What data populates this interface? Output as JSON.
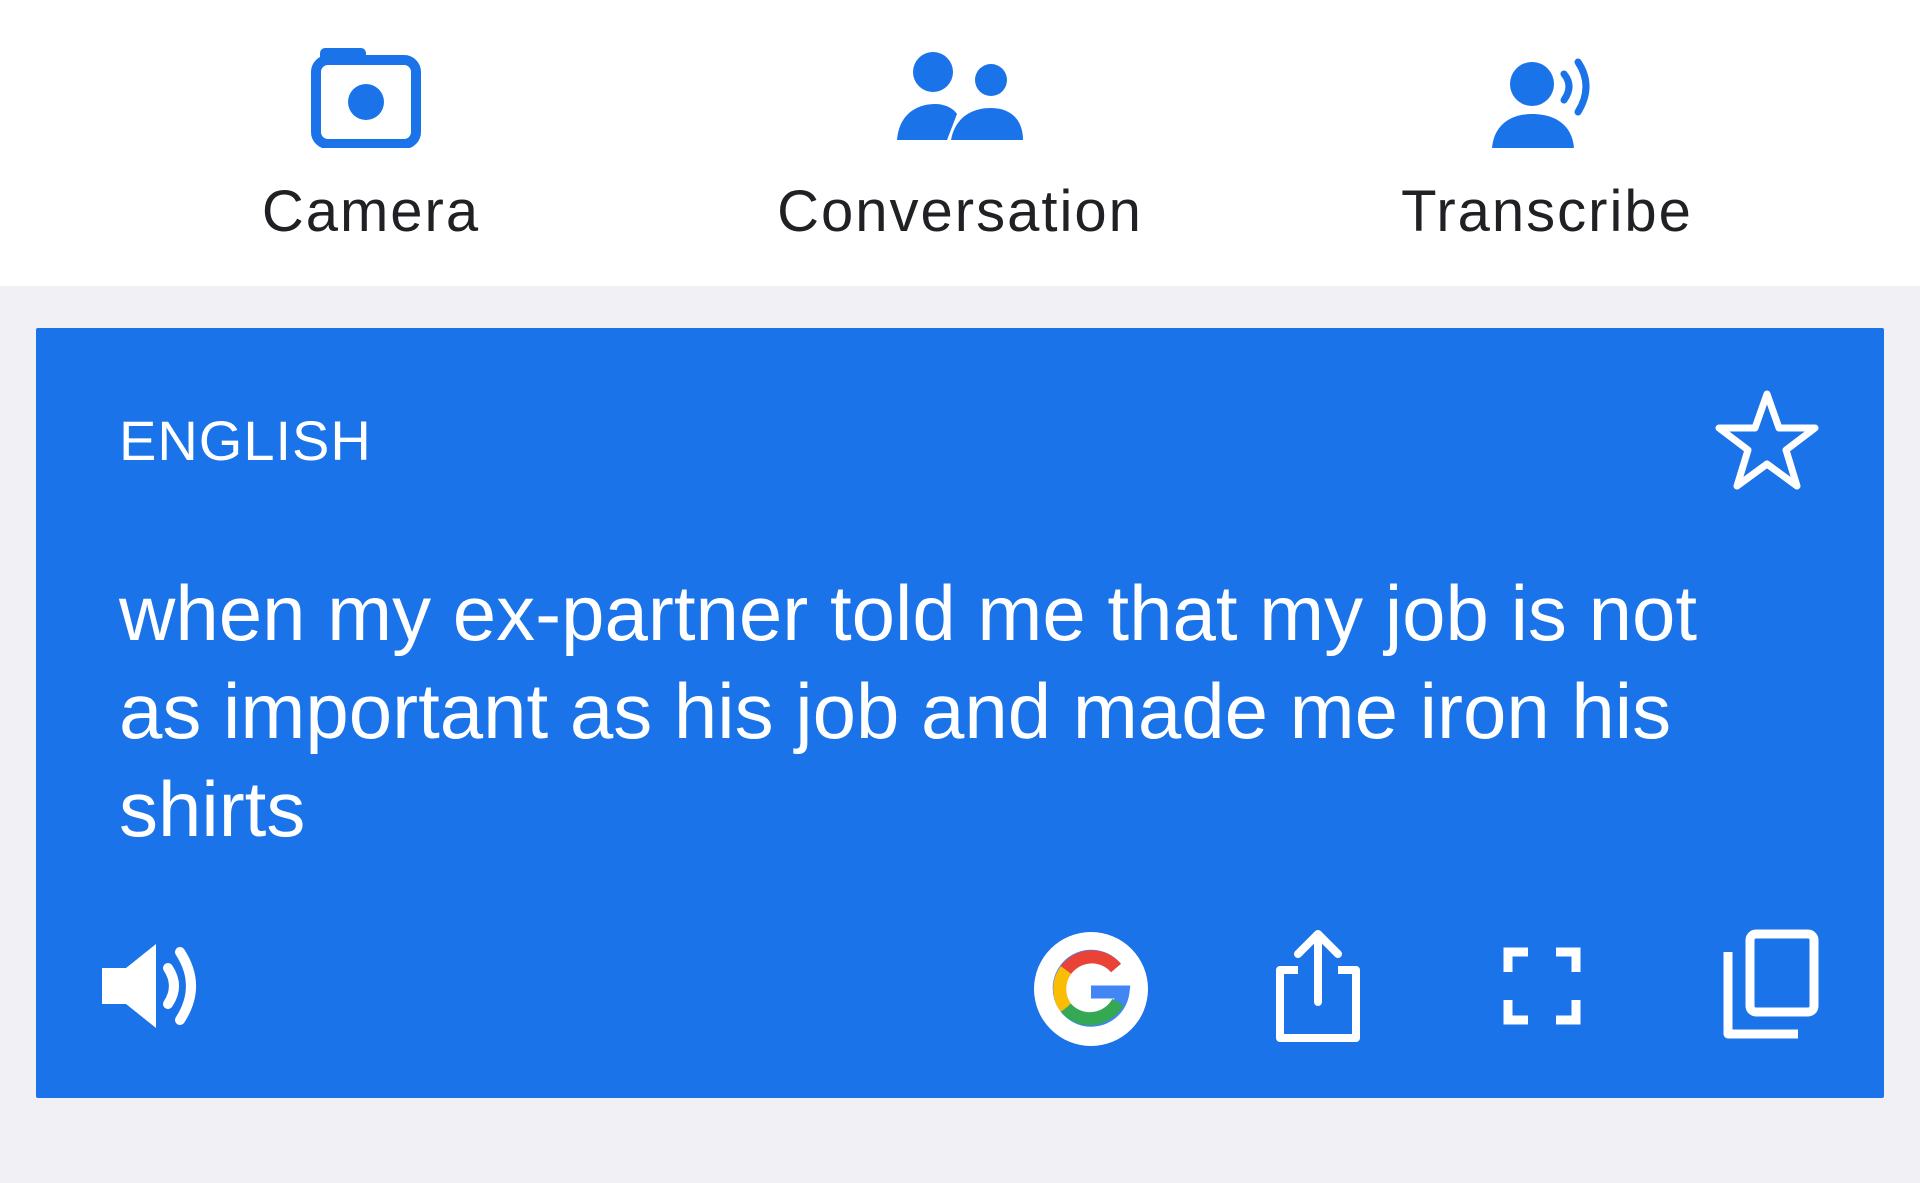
{
  "modes": {
    "camera": {
      "label": "Camera",
      "icon": "camera-icon"
    },
    "conversation": {
      "label": "Conversation",
      "icon": "people-icon"
    },
    "transcribe": {
      "label": "Transcribe",
      "icon": "voice-person-icon"
    }
  },
  "translation": {
    "language": "ENGLISH",
    "text": "when my ex-partner told me that my job is not as important as his job and made me iron his shirts",
    "actions": [
      "star-icon",
      "speaker-icon",
      "google-icon",
      "share-icon",
      "fullscreen-icon",
      "copy-icon"
    ]
  },
  "colors": {
    "accent": "#1a73e8",
    "card_text": "#ffffff",
    "label_text": "#202124",
    "background": "#f1f1f5"
  }
}
